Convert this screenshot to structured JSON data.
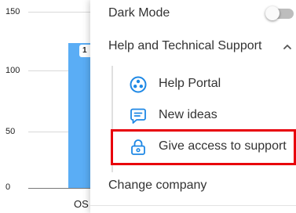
{
  "chart": {
    "y_ticks": [
      "150",
      "100",
      "50",
      "0"
    ],
    "bar_label": "1",
    "x_label": "OS"
  },
  "menu": {
    "dark_mode": {
      "label": "Dark Mode",
      "enabled": false
    },
    "help_section": {
      "label": "Help and Technical Support",
      "expanded": true,
      "items": [
        {
          "label": "Help Portal",
          "icon": "help-portal-icon"
        },
        {
          "label": "New ideas",
          "icon": "chat-bubble-icon"
        },
        {
          "label": "Give access to support",
          "icon": "lock-icon",
          "highlighted": true
        }
      ]
    },
    "change_company": {
      "label": "Change company"
    }
  },
  "colors": {
    "accent": "#1e88e5",
    "highlight": "#e8000b",
    "bar": "#5aadf5"
  }
}
